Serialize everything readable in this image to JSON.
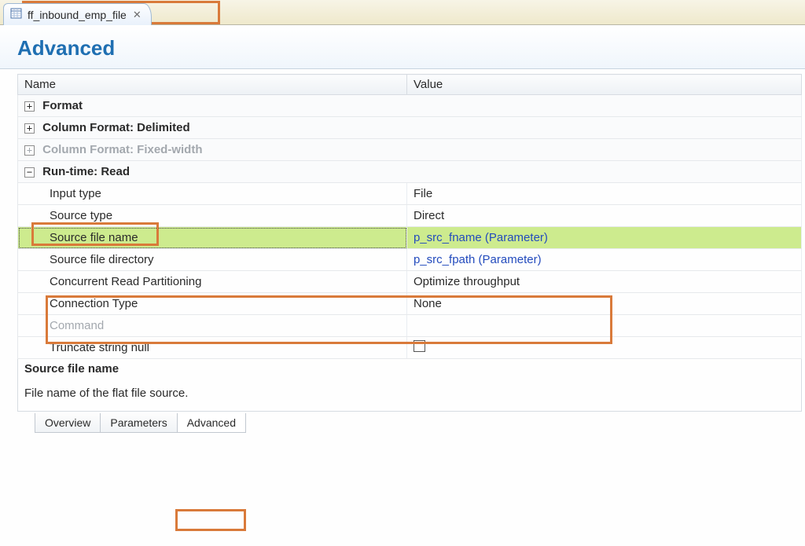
{
  "file_tab": {
    "label": "ff_inbound_emp_file"
  },
  "page_title": "Advanced",
  "columns": {
    "name": "Name",
    "value": "Value"
  },
  "groups": {
    "format": {
      "label": "Format",
      "expanded": false
    },
    "col_delim": {
      "label": "Column Format: Delimited",
      "expanded": false
    },
    "col_fixed": {
      "label": "Column Format: Fixed-width",
      "expanded": false,
      "disabled": true
    },
    "runtime_read": {
      "label": "Run-time: Read",
      "expanded": true
    }
  },
  "runtime_read_rows": [
    {
      "name": "Input type",
      "value": "File"
    },
    {
      "name": "Source type",
      "value": "Direct"
    },
    {
      "name": "Source file name",
      "value": "p_src_fname (Parameter)",
      "param": true,
      "highlight": true,
      "selected": true
    },
    {
      "name": "Source file directory",
      "value": "p_src_fpath (Parameter)",
      "param": true
    },
    {
      "name": "Concurrent Read Partitioning",
      "value": "Optimize throughput"
    },
    {
      "name": "Connection Type",
      "value": "None"
    },
    {
      "name": "Command",
      "value": "",
      "disabled": true
    },
    {
      "name": "Truncate string null",
      "value": "",
      "checkbox": true
    }
  ],
  "description": {
    "title": "Source file name",
    "body": "File name of the flat file source."
  },
  "bottom_tabs": [
    {
      "label": "Overview",
      "active": false
    },
    {
      "label": "Parameters",
      "active": false
    },
    {
      "label": "Advanced",
      "active": true
    }
  ],
  "icons": {
    "close_glyph": "✕",
    "plus": "+",
    "minus": "−"
  }
}
